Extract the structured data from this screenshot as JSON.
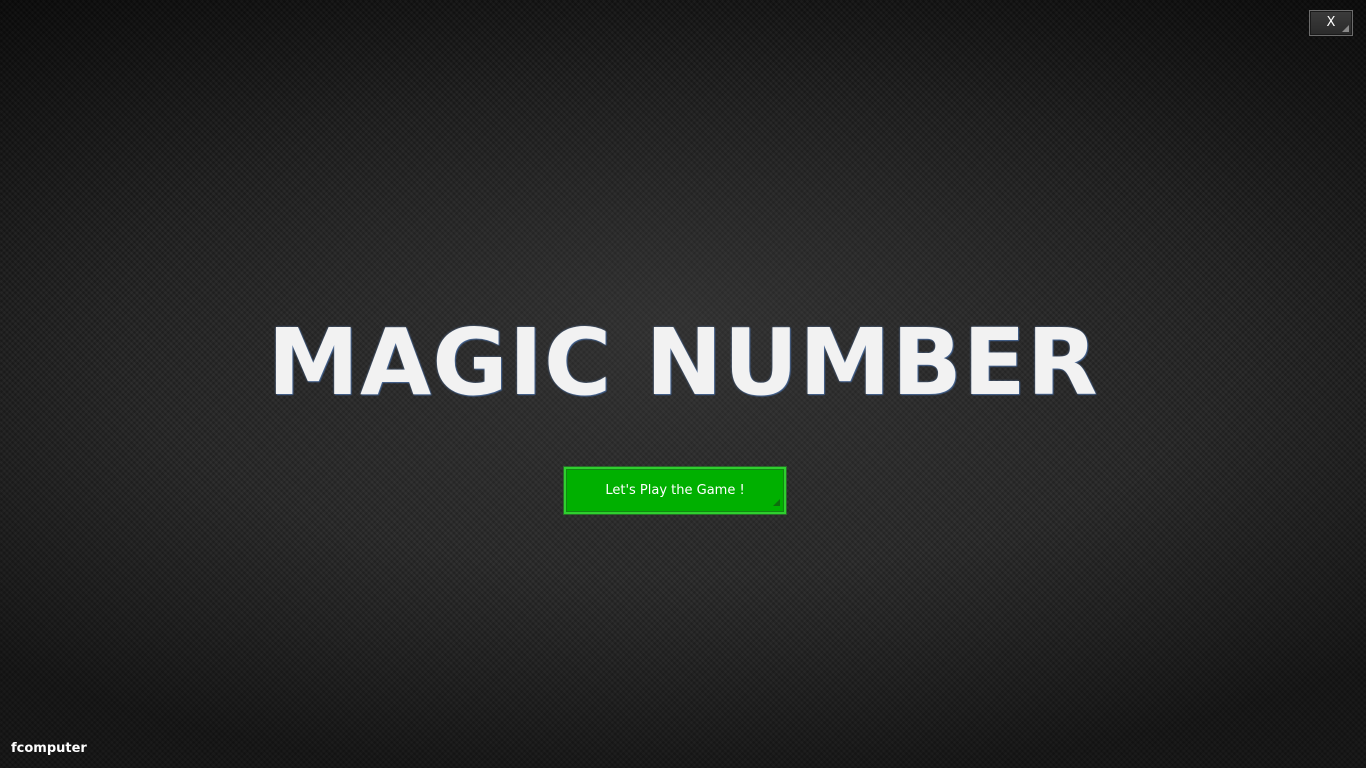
{
  "window": {
    "close_label": "X"
  },
  "main": {
    "title": "MAGIC NUMBER",
    "play_button_label": "Let's Play the Game !"
  },
  "footer": {
    "label": "fcomputer"
  },
  "colors": {
    "background": "#1c1c1c",
    "title_text": "#f2f2f2",
    "play_button": "#00b000",
    "close_button": "#333333"
  }
}
